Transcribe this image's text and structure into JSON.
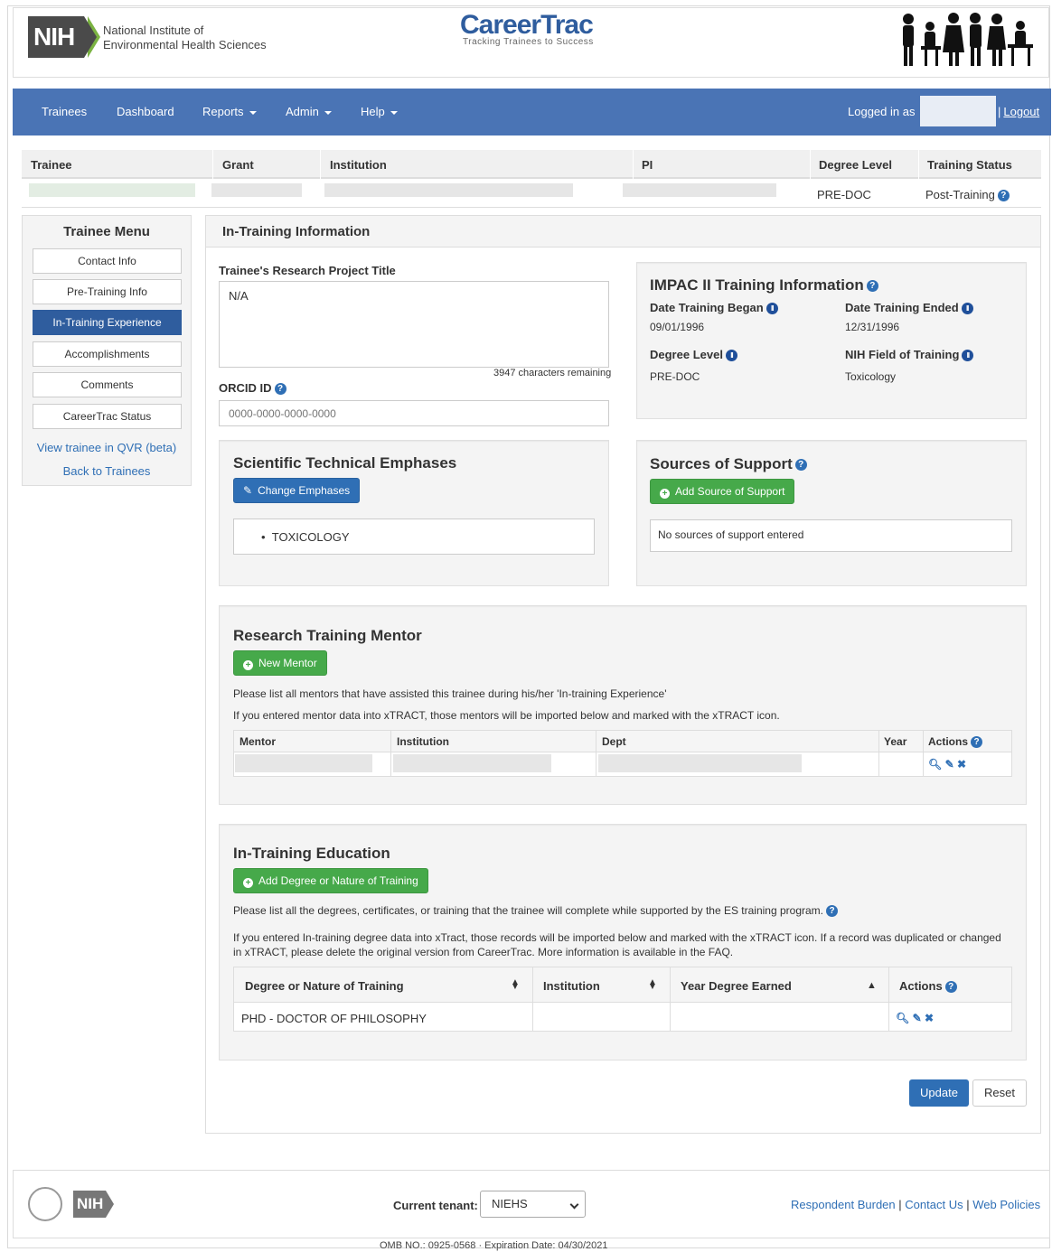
{
  "header": {
    "org_line1": "National Institute of",
    "org_line2": "Environmental Health Sciences",
    "nih_logo": "NIH",
    "app_title": "CareerTrac",
    "app_tagline": "Tracking Trainees to Success"
  },
  "nav": {
    "items": [
      "Trainees",
      "Dashboard",
      "Reports",
      "Admin",
      "Help"
    ],
    "logged_in": "Logged in as",
    "logout": "Logout"
  },
  "trainee_table": {
    "headers": [
      "Trainee",
      "Grant",
      "Institution",
      "PI",
      "Degree Level",
      "Training Status"
    ],
    "degree_level": "PRE-DOC",
    "training_status": "Post-Training"
  },
  "sidebar": {
    "title": "Trainee Menu",
    "items": [
      "Contact Info",
      "Pre-Training Info",
      "In-Training Experience",
      "Accomplishments",
      "Comments",
      "CareerTrac Status"
    ],
    "links": [
      "View trainee in QVR (beta)",
      "Back to Trainees"
    ]
  },
  "main": {
    "title": "In-Training Information",
    "project_title_label": "Trainee's Research Project Title",
    "project_title_value": "N/A",
    "chars_remaining": "3947 characters remaining",
    "orcid_label": "ORCID ID",
    "orcid_placeholder": "0000-0000-0000-0000",
    "impac": {
      "title": "IMPAC II Training Information",
      "date_began_label": "Date Training Began",
      "date_began": "09/01/1996",
      "date_ended_label": "Date Training Ended",
      "date_ended": "12/31/1996",
      "degree_level_label": "Degree Level",
      "degree_level": "PRE-DOC",
      "field_label": "NIH Field of Training",
      "field": "Toxicology"
    },
    "emphases": {
      "title": "Scientific Technical Emphases",
      "button": "Change Emphases",
      "items": [
        "TOXICOLOGY"
      ]
    },
    "support": {
      "title": "Sources of Support",
      "button": "Add Source of Support",
      "empty": "No sources of support entered"
    },
    "mentor": {
      "title": "Research Training Mentor",
      "button": "New Mentor",
      "note1": "Please list all mentors that have assisted this trainee during his/her 'In-training Experience'",
      "note2": "If you entered mentor data into xTRACT, those mentors will be imported below and marked with the xTRACT icon.",
      "headers": [
        "Mentor",
        "Institution",
        "Dept",
        "Year",
        "Actions"
      ]
    },
    "education": {
      "title": "In-Training Education",
      "button": "Add Degree or Nature of Training",
      "note1": "Please list all the degrees, certificates, or training that the trainee will complete while supported by the ES training program.",
      "note2": "If you entered In-training degree data into xTract, those records will be imported below and marked with the xTRACT icon. If a record was duplicated or changed in xTRACT, please delete the original version from CareerTrac. More information is available in the FAQ.",
      "headers": [
        "Degree or Nature of Training",
        "Institution",
        "Year Degree Earned",
        "Actions"
      ],
      "rows": [
        [
          "PHD - DOCTOR OF PHILOSOPHY",
          "",
          ""
        ]
      ]
    },
    "update_button": "Update",
    "reset_button": "Reset"
  },
  "footer": {
    "nih_logo": "NIH",
    "tenant_label": "Current tenant:",
    "tenant_value": "NIEHS",
    "links": [
      "Respondent Burden",
      "Contact Us",
      "Web Policies"
    ],
    "separator": "|",
    "omb": "OMB NO.: 0925-0568 · Expiration Date: 04/30/2021"
  },
  "colors": {
    "nav_bg": "#4a74b5",
    "primary_button": "#2f6fb5",
    "success_button": "#46a94a",
    "active_menu": "#2f5d9e"
  }
}
